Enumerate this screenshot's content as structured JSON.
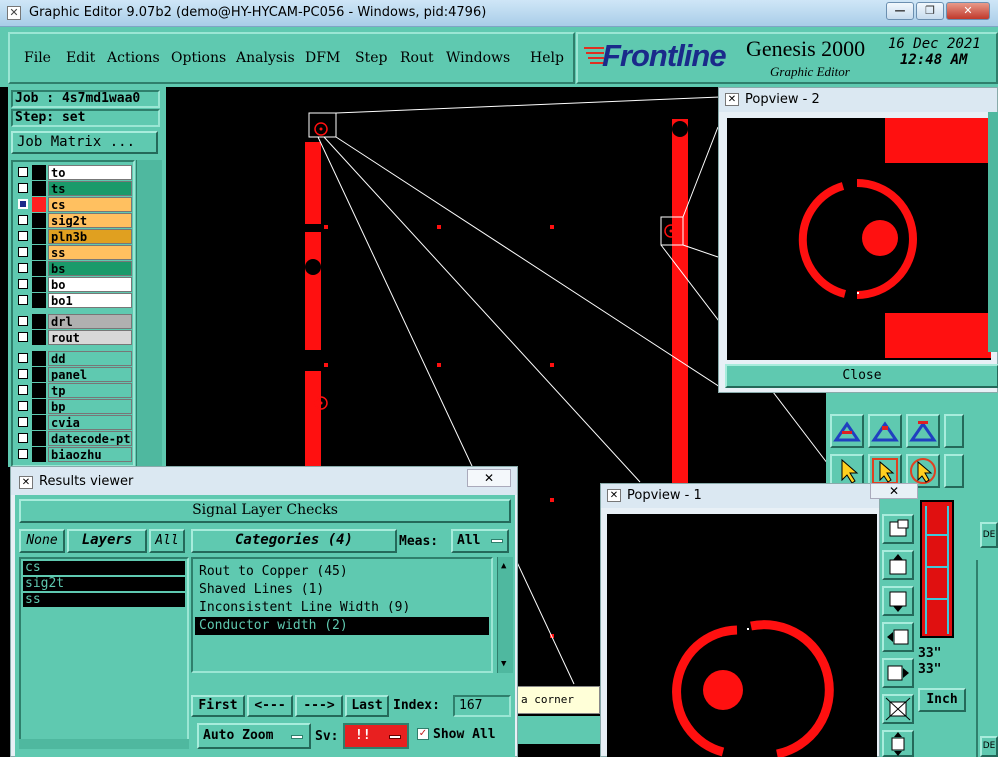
{
  "window": {
    "title": "Graphic Editor 9.07b2 (demo@HY-HYCAM-PC056 - Windows, pid:4796)",
    "icon": "x-window-icon"
  },
  "menu": {
    "items": [
      "File",
      "Edit",
      "Actions",
      "Options",
      "Analysis",
      "DFM",
      "Step",
      "Rout",
      "Windows",
      "Help"
    ]
  },
  "brand": {
    "logo": "Frontline",
    "product": "Genesis 2000",
    "subtitle": "Graphic Editor",
    "date": "16 Dec 2021",
    "time": "12:48 AM"
  },
  "job": {
    "job_label": "Job : 4s7md1waa0",
    "step_label": "Step: set",
    "job_matrix_button": "Job Matrix ..."
  },
  "layers": [
    {
      "name": "to",
      "color": "#ffffff",
      "swatch": "#000000"
    },
    {
      "name": "ts",
      "color": "#1a9a6a",
      "swatch": "#000000"
    },
    {
      "name": "cs",
      "color": "#ffc060",
      "swatch": "#ff2020",
      "active": true
    },
    {
      "name": "sig2t",
      "color": "#ffc060",
      "swatch": "#000000"
    },
    {
      "name": "pln3b",
      "color": "#e0a020",
      "swatch": "#000000"
    },
    {
      "name": "ss",
      "color": "#ffc060",
      "swatch": "#000000"
    },
    {
      "name": "bs",
      "color": "#1a9a6a",
      "swatch": "#000000"
    },
    {
      "name": "bo",
      "color": "#ffffff",
      "swatch": "#000000"
    },
    {
      "name": "bo1",
      "color": "#ffffff",
      "swatch": "#000000"
    },
    {
      "name": "drl",
      "color": "#b0b0b0",
      "swatch": "#000000"
    },
    {
      "name": "rout",
      "color": "#d8d8d8",
      "swatch": "#000000"
    },
    {
      "name": "dd",
      "color": "#5fc9b0",
      "swatch": "#000000"
    },
    {
      "name": "panel",
      "color": "#5fc9b0",
      "swatch": "#000000"
    },
    {
      "name": "tp",
      "color": "#5fc9b0",
      "swatch": "#000000"
    },
    {
      "name": "bp",
      "color": "#5fc9b0",
      "swatch": "#000000"
    },
    {
      "name": "cvia",
      "color": "#5fc9b0",
      "swatch": "#000000"
    },
    {
      "name": "datecode-pto",
      "color": "#5fc9b0",
      "swatch": "#000000"
    },
    {
      "name": "biaozhu",
      "color": "#5fc9b0",
      "swatch": "#000000"
    }
  ],
  "popview2": {
    "title": "Popview - 2",
    "close_label": "Close"
  },
  "popview1": {
    "title": "Popview - 1"
  },
  "results": {
    "title": "Results viewer",
    "header": "Signal Layer Checks",
    "none_label": "None",
    "layers_label": "Layers",
    "all_label": "All",
    "categories_label": "Categories (4)",
    "meas_label": "Meas:",
    "meas_value": "All",
    "layer_list": [
      "cs",
      "sig2t",
      "ss"
    ],
    "categories": [
      "Rout to Copper (45)",
      "Shaved Lines (1)",
      "Inconsistent Line Width (9)",
      "Conductor width (2)"
    ],
    "selected_category": 3,
    "first_label": "First",
    "prev_label": "<---",
    "next_label": "--->",
    "last_label": "Last",
    "index_label": "Index:",
    "index_value": "167",
    "auto_zoom_label": "Auto Zoom",
    "sv_label": "Sv:",
    "sv_value": "!!",
    "show_all_label": "Show All"
  },
  "canvas": {
    "status_hint": "a corner"
  },
  "right_panel": {
    "dim1": "33\"",
    "dim2": "33\"",
    "unit": "Inch",
    "de_label": "DE"
  },
  "colors": {
    "teal": "#5fc9b0",
    "feature_red": "#ff1010",
    "canvas": "#000000",
    "selected_row": "#000000"
  }
}
